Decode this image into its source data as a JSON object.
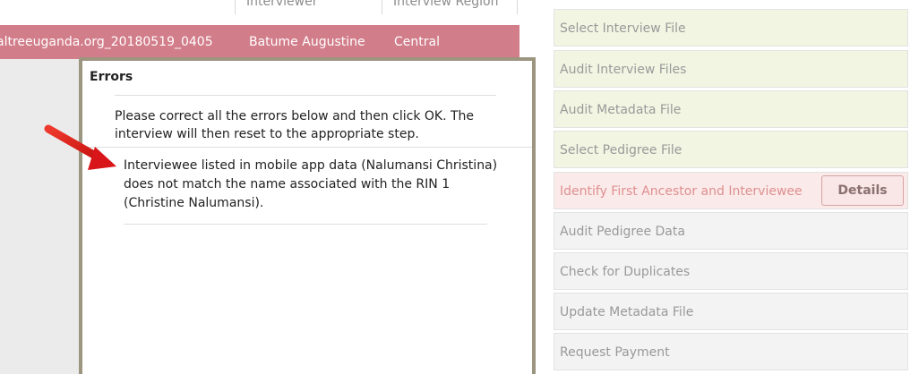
{
  "table": {
    "headers": {
      "interviewer": "Interviewer",
      "region": "Interview Region"
    },
    "row": {
      "file": "altreeuganda.org_20180519_0405",
      "interviewer": "Batume Augustine",
      "region": "Central"
    }
  },
  "dialog": {
    "title": "Errors",
    "message": "Please correct all the errors below and then click OK. The interview will then reset to the appropriate step.",
    "errors": [
      "Interviewee listed in mobile app data (Nalumansi Christina) does not match the name associated with the RIN 1 (Christine Nalumansi)."
    ]
  },
  "steps": [
    {
      "label": "Select Interview File",
      "status": "done"
    },
    {
      "label": "Audit Interview Files",
      "status": "done"
    },
    {
      "label": "Audit Metadata File",
      "status": "done"
    },
    {
      "label": "Select Pedigree File",
      "status": "done"
    },
    {
      "label": "Identify First Ancestor and Interviewee",
      "status": "error",
      "button": "Details"
    },
    {
      "label": "Audit Pedigree Data",
      "status": "pending"
    },
    {
      "label": "Check for Duplicates",
      "status": "pending"
    },
    {
      "label": "Update Metadata File",
      "status": "pending"
    },
    {
      "label": "Request Payment",
      "status": "pending"
    }
  ],
  "colors": {
    "selected_row": "#d27d8a",
    "dialog_border": "#9c9580",
    "step_done": "#f1f5e2",
    "step_error": "#fbeaea",
    "step_pending": "#f3f3f3",
    "arrow": "#e0201c"
  },
  "icons": {
    "annotation": "red-arrow-icon"
  }
}
